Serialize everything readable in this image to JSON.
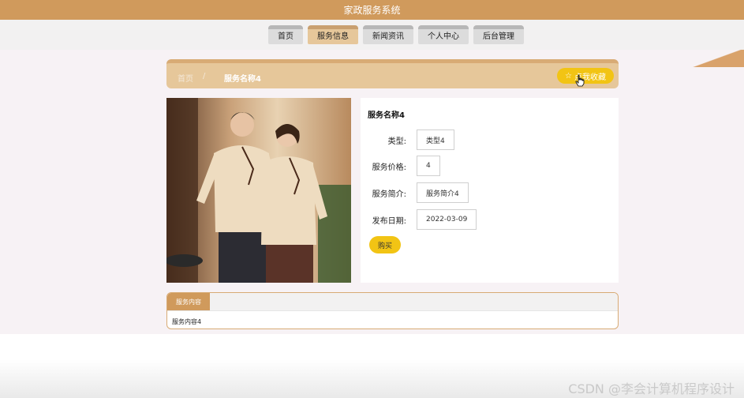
{
  "header": {
    "title": "家政服务系统"
  },
  "nav": {
    "items": [
      {
        "label": "首页"
      },
      {
        "label": "服务信息",
        "active": true
      },
      {
        "label": "新闻资讯"
      },
      {
        "label": "个人中心"
      },
      {
        "label": "后台管理"
      }
    ]
  },
  "breadcrumb": {
    "home": "首页",
    "separator": "/",
    "current": "服务名称4",
    "favorite_label": "点我收藏",
    "favorite_icon": "star-icon"
  },
  "detail": {
    "title": "服务名称4",
    "fields": [
      {
        "label": "类型:",
        "value": "类型4"
      },
      {
        "label": "服务价格:",
        "value": "4"
      },
      {
        "label": "服务简介:",
        "value": "服务简介4"
      },
      {
        "label": "发布日期:",
        "value": "2022-03-09"
      }
    ],
    "buy_label": "购买"
  },
  "content": {
    "tab_label": "服务内容",
    "text": "服务内容4"
  },
  "watermark": "CSDN @李会计算机程序设计",
  "colors": {
    "header": "#d09a5c",
    "accent": "#f2c414",
    "breadcrumb_bg": "#e6c79a"
  }
}
